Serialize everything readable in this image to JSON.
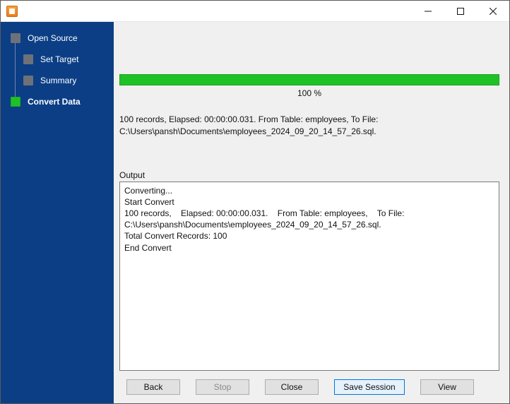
{
  "window": {
    "title": ""
  },
  "sidebar": {
    "items": [
      {
        "label": "Open Source",
        "level": 0,
        "active": false
      },
      {
        "label": "Set Target",
        "level": 1,
        "active": false
      },
      {
        "label": "Summary",
        "level": 1,
        "active": false
      },
      {
        "label": "Convert Data",
        "level": 0,
        "active": true
      }
    ]
  },
  "progress": {
    "percent_label": "100 %"
  },
  "summary": {
    "text": "100 records,    Elapsed: 00:00:00.031.    From Table: employees,    To File: C:\\Users\\pansh\\Documents\\employees_2024_09_20_14_57_26.sql."
  },
  "output": {
    "label": "Output",
    "text": "Converting...\nStart Convert\n100 records,    Elapsed: 00:00:00.031.    From Table: employees,    To File: C:\\Users\\pansh\\Documents\\employees_2024_09_20_14_57_26.sql.\nTotal Convert Records: 100\nEnd Convert"
  },
  "buttons": {
    "back": "Back",
    "stop": "Stop",
    "close": "Close",
    "save_session": "Save Session",
    "view": "View"
  }
}
